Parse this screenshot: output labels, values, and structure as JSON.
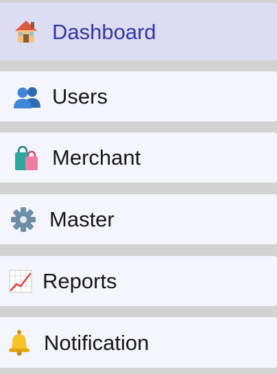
{
  "sidebar": {
    "active_color": "#3236a8",
    "active_background": "#dcdcf4",
    "item_background": "#f5f6fd",
    "items": [
      {
        "label": "Dashboard",
        "icon": "house-icon",
        "active": true
      },
      {
        "label": "Users",
        "icon": "users-icon",
        "active": false
      },
      {
        "label": "Merchant",
        "icon": "shopping-bags-icon",
        "active": false
      },
      {
        "label": "Master",
        "icon": "gear-icon",
        "active": false
      },
      {
        "label": "Reports",
        "icon": "chart-increasing-icon",
        "active": false
      },
      {
        "label": "Notification",
        "icon": "bell-icon",
        "active": false
      }
    ]
  }
}
